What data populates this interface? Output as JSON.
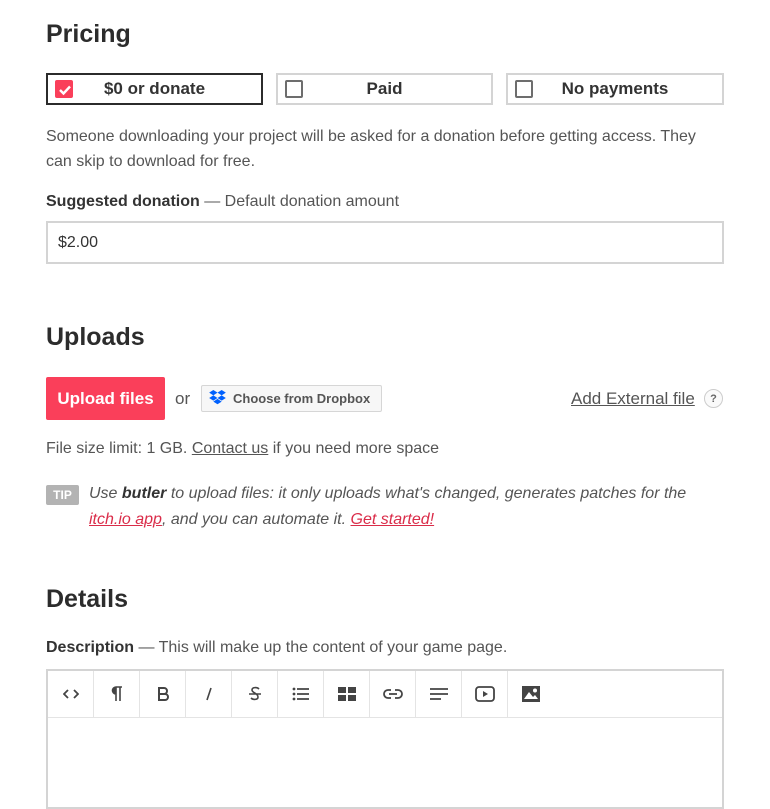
{
  "pricing": {
    "heading": "Pricing",
    "options": [
      {
        "label": "$0 or donate",
        "checked": true
      },
      {
        "label": "Paid",
        "checked": false
      },
      {
        "label": "No payments",
        "checked": false
      }
    ],
    "description": "Someone downloading your project will be asked for a donation before getting access. They can skip to download for free.",
    "suggested_label": "Suggested donation",
    "suggested_hint": "— Default donation amount",
    "suggested_value": "$2.00"
  },
  "uploads": {
    "heading": "Uploads",
    "upload_button": "Upload files",
    "or_text": "or",
    "dropbox_button": "Choose from Dropbox",
    "external_link": "Add External file",
    "help_symbol": "?",
    "size_limit_text": "File size limit: 1 GB.",
    "contact_link": "Contact us",
    "size_suffix": "if you need more space",
    "tip_badge": "TIP",
    "tip_prefix": "Use",
    "tip_butler": "butler",
    "tip_middle": "to upload files: it only uploads what's changed, generates patches for the",
    "tip_app_link": "itch.io app",
    "tip_after_link": ", and you can automate it.",
    "tip_get_started": "Get started!"
  },
  "details": {
    "heading": "Details",
    "description_label": "Description",
    "description_hint": "— This will make up the content of your game page.",
    "toolbar_icons": [
      "code-icon",
      "paragraph-icon",
      "bold-icon",
      "italic-icon",
      "strikethrough-icon",
      "list-icon",
      "table-icon",
      "link-icon",
      "align-icon",
      "video-icon",
      "image-icon"
    ]
  },
  "colors": {
    "accent": "#fa3f5a",
    "link_red": "#da2c49",
    "tip_badge": "#b3b3b3"
  }
}
